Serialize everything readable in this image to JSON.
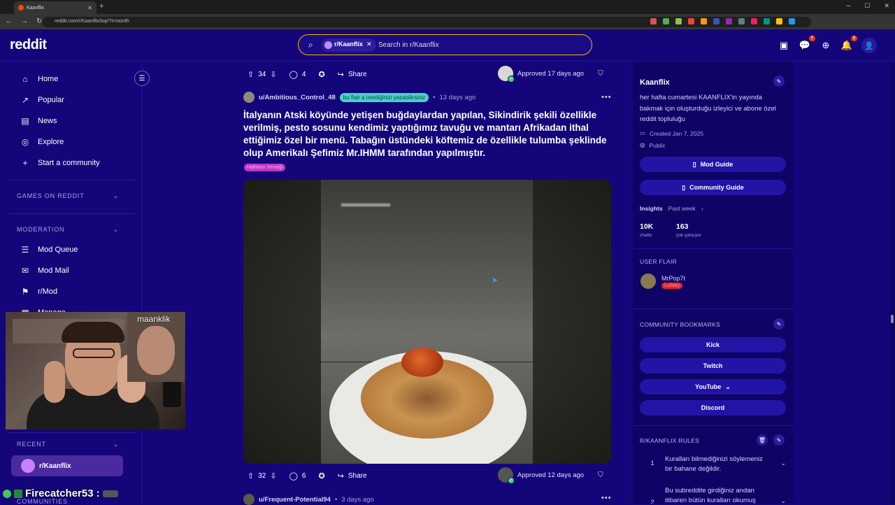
{
  "browser": {
    "tab_title": "Kaanflix",
    "url": "reddit.com/r/Kaanflix/top/?t=month",
    "new_tab": "+",
    "ext_colors": [
      "#d9534f",
      "#4caf50",
      "#8bc34a",
      "#f44336",
      "#ff9800",
      "#3f51b5",
      "#9c27b0",
      "#607d8b",
      "#e91e63",
      "#009688",
      "#ffc107",
      "#2196f3"
    ]
  },
  "header": {
    "logo": "reddit",
    "search_chip": "r/Kaanflix",
    "search_placeholder": "Search in r/Kaanflix",
    "chat_badge": "7",
    "notif_badge": "3"
  },
  "left_nav": {
    "items": [
      {
        "icon": "home-icon",
        "label": "Home"
      },
      {
        "icon": "popular-icon",
        "label": "Popular"
      },
      {
        "icon": "news-icon",
        "label": "News"
      },
      {
        "icon": "explore-icon",
        "label": "Explore"
      },
      {
        "icon": "plus-icon",
        "label": "Start a community"
      }
    ],
    "games_heading": "GAMES ON REDDIT",
    "moderation_heading": "MODERATION",
    "mod_items": [
      {
        "icon": "queue-icon",
        "label": "Mod Queue"
      },
      {
        "icon": "mail-icon",
        "label": "Mod Mail"
      },
      {
        "icon": "mod-icon",
        "label": "r/Mod"
      }
    ],
    "manage_partial": "Manage",
    "recent_heading": "RECENT",
    "recent_item": "r/Kaanflix",
    "communities_partial": "COMMUNITIES"
  },
  "stream_overlay": {
    "cam_name": "maanklik",
    "chat_user": "Firecatcher53",
    "chat_colon": ":"
  },
  "prev_post_actions": {
    "upvotes": "34",
    "comments": "4",
    "share": "Share",
    "approved": "Approved 17 days ago"
  },
  "post": {
    "author": "u/Ambitious_Control_48",
    "user_flair": "bu flair a istediğinizi yazabilirsiniz",
    "age": "13 days ago",
    "title": "İtalyanın Atski köyünde yetişen buğdaylardan yapılan, Sikindirik şekili özellikle verilmiş, pesto sosunu kendimiz yaptığımız tavuğu ve mantarı Afrikadan ithal ettiğimiz özel bir menü. Tabağın üstündeki köftemiz de özellikle tulumba şeklinde olup Amerikalı Şefimiz Mr.IHMM tarafından yapılmıştır.",
    "post_flair": "Haftanın Yemeği",
    "upvotes": "32",
    "comments": "6",
    "share": "Share",
    "approved": "Approved 12 days ago"
  },
  "next_post": {
    "author": "u/Frequent-Potential94",
    "age": "3 days ago"
  },
  "community": {
    "name": "Kaanflix",
    "description": "her hafta cumartesi KAANFLIX'in yayında bakmak için oluşturduğu izleyici ve abone özel reddit topluluğu",
    "created": "Created Jan 7, 2025",
    "visibility": "Public",
    "mod_guide": "Mod Guide",
    "community_guide": "Community Guide",
    "insights_label": "Insights",
    "insights_period": "Past week",
    "stat1_value": "10K",
    "stat1_label": "chatto",
    "stat2_value": "163",
    "stat2_label": "çok çalışıyor",
    "user_flair_heading": "USER FLAIR",
    "user_flair_name": "MrPop7t",
    "user_flair_tag": "Lullaby",
    "bookmarks_heading": "COMMUNITY BOOKMARKS",
    "bookmarks": [
      "Kick",
      "Twitch",
      "YouTube",
      "Discord"
    ],
    "rules_heading": "R/KAANFLIX RULES",
    "rules": [
      {
        "n": "1",
        "text": "Kuralları bilmediğinizi söylemeniz bir bahane değildir."
      },
      {
        "n": "2",
        "text": "Bu subreddite girdiğiniz andan itibaren bütün kuralları okumuş"
      }
    ]
  }
}
